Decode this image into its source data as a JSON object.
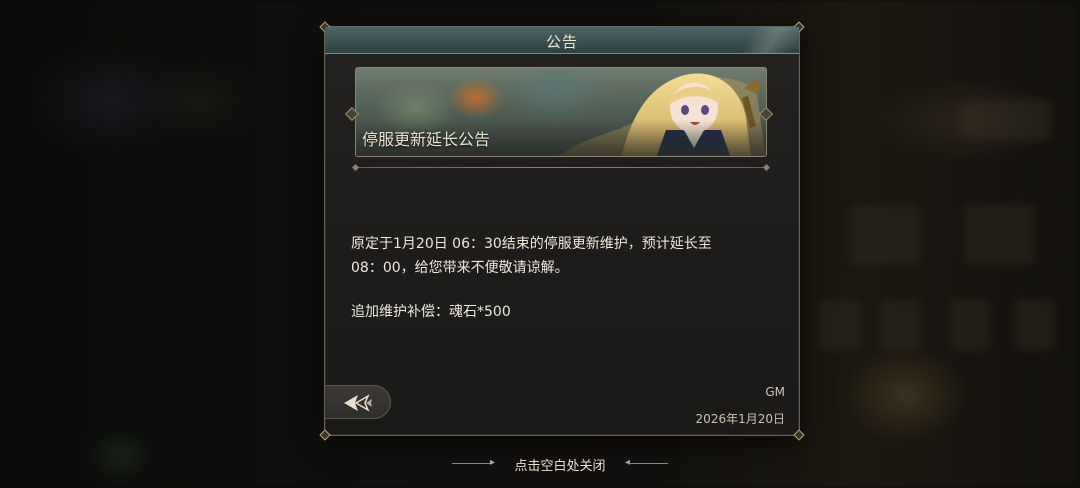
{
  "dialog": {
    "title": "公告",
    "banner_label": "停服更新延长公告",
    "body": {
      "line1": "原定于1月20日 06：30结束的停服更新维护，预计延长至",
      "line2": "08：00，给您带来不便敬请谅解。",
      "line3": "追加维护补偿：魂石*500"
    },
    "author": "GM",
    "date": "2026年1月20日",
    "back_icon": "back-arrow-icon"
  },
  "footer": {
    "close_hint": "点击空白处关闭"
  },
  "colors": {
    "header": "#3c5151",
    "panel": "#1d1c1a",
    "border": "#6b6452",
    "text": "#ece8dc"
  }
}
